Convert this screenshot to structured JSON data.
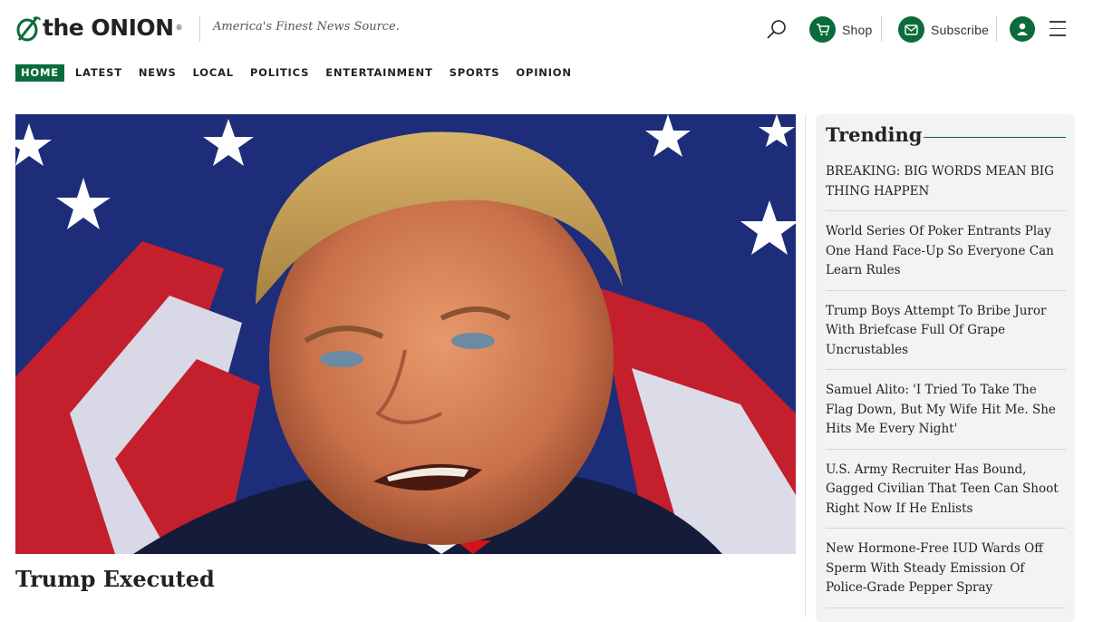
{
  "brand": {
    "logo_text": "the ONION",
    "tagline": "America's Finest News Source.",
    "accent_color": "#0b6b3a"
  },
  "header": {
    "search_icon": "search-icon",
    "shop_label": "Shop",
    "subscribe_label": "Subscribe",
    "account_icon": "user-icon",
    "menu_icon": "hamburger-menu-icon"
  },
  "nav": {
    "items": [
      {
        "label": "HOME",
        "active": true
      },
      {
        "label": "LATEST"
      },
      {
        "label": "NEWS"
      },
      {
        "label": "LOCAL"
      },
      {
        "label": "POLITICS"
      },
      {
        "label": "ENTERTAINMENT"
      },
      {
        "label": "SPORTS"
      },
      {
        "label": "OPINION"
      }
    ]
  },
  "hero": {
    "headline": "Trump Executed"
  },
  "trending": {
    "title": "Trending",
    "items": [
      "BREAKING: BIG WORDS MEAN BIG THING HAPPEN",
      "World Series Of Poker Entrants Play One Hand Face-Up So Everyone Can Learn Rules",
      "Trump Boys Attempt To Bribe Juror With Briefcase Full Of Grape Uncrustables",
      "Samuel Alito: 'I Tried To Take The Flag Down, But My Wife Hit Me. She Hits Me Every Night'",
      "U.S. Army Recruiter Has Bound, Gagged Civilian That Teen Can Shoot Right Now If He Enlists",
      "New Hormone-Free IUD Wards Off Sperm With Steady Emission Of Police-Grade Pepper Spray"
    ]
  }
}
